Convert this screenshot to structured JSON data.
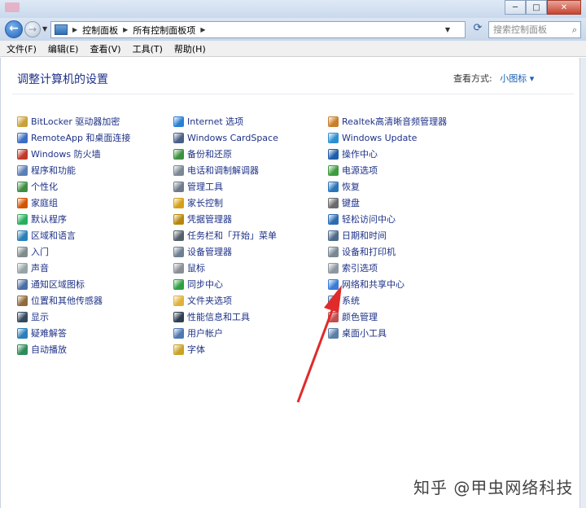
{
  "window": {
    "minimize_glyph": "─",
    "maximize_glyph": "□",
    "close_glyph": "✕"
  },
  "address": {
    "crumbs": [
      "控制面板",
      "所有控制面板项"
    ],
    "search_placeholder": "搜索控制面板"
  },
  "menu": [
    "文件(F)",
    "编辑(E)",
    "查看(V)",
    "工具(T)",
    "帮助(H)"
  ],
  "header": {
    "title": "调整计算机的设置",
    "view_by_label": "查看方式:",
    "view_by_value": "小图标 ▾"
  },
  "items": {
    "col1": [
      {
        "label": "BitLocker 驱动器加密",
        "color": "#c9a13a"
      },
      {
        "label": "RemoteApp 和桌面连接",
        "color": "#3a6fc4"
      },
      {
        "label": "Windows 防火墙",
        "color": "#c0392b"
      },
      {
        "label": "程序和功能",
        "color": "#5b7fb5"
      },
      {
        "label": "个性化",
        "color": "#3e8e41"
      },
      {
        "label": "家庭组",
        "color": "#d35400"
      },
      {
        "label": "默认程序",
        "color": "#27ae60"
      },
      {
        "label": "区域和语言",
        "color": "#2980b9"
      },
      {
        "label": "入门",
        "color": "#7f8c8d"
      },
      {
        "label": "声音",
        "color": "#95a5a6"
      },
      {
        "label": "通知区域图标",
        "color": "#4a6fa5"
      },
      {
        "label": "位置和其他传感器",
        "color": "#8e6b3a"
      },
      {
        "label": "显示",
        "color": "#34495e"
      },
      {
        "label": "疑难解答",
        "color": "#2c7fb8"
      },
      {
        "label": "自动播放",
        "color": "#2e8b57"
      }
    ],
    "col2": [
      {
        "label": "Internet 选项",
        "color": "#2a7fd4"
      },
      {
        "label": "Windows CardSpace",
        "color": "#4b5f86"
      },
      {
        "label": "备份和还原",
        "color": "#3d9140"
      },
      {
        "label": "电话和调制解调器",
        "color": "#7b8794"
      },
      {
        "label": "管理工具",
        "color": "#6c7a89"
      },
      {
        "label": "家长控制",
        "color": "#d4a017"
      },
      {
        "label": "凭据管理器",
        "color": "#b8860b"
      },
      {
        "label": "任务栏和「开始」菜单",
        "color": "#555f6b"
      },
      {
        "label": "设备管理器",
        "color": "#6d7f93"
      },
      {
        "label": "鼠标",
        "color": "#8a8f96"
      },
      {
        "label": "同步中心",
        "color": "#2ea043"
      },
      {
        "label": "文件夹选项",
        "color": "#e0b23c"
      },
      {
        "label": "性能信息和工具",
        "color": "#2d3e50"
      },
      {
        "label": "用户帐户",
        "color": "#4f77b0"
      },
      {
        "label": "字体",
        "color": "#c9a227"
      }
    ],
    "col3": [
      {
        "label": "Realtek高清晰音频管理器",
        "color": "#c87f2a"
      },
      {
        "label": "Windows Update",
        "color": "#2d8fd0"
      },
      {
        "label": "操作中心",
        "color": "#1f5fa8"
      },
      {
        "label": "电源选项",
        "color": "#3e9b3e"
      },
      {
        "label": "恢复",
        "color": "#2a74b8"
      },
      {
        "label": "键盘",
        "color": "#6b6b6b"
      },
      {
        "label": "轻松访问中心",
        "color": "#2b6cb0"
      },
      {
        "label": "日期和时间",
        "color": "#4e6a8a"
      },
      {
        "label": "设备和打印机",
        "color": "#7a8894"
      },
      {
        "label": "索引选项",
        "color": "#8d96a0"
      },
      {
        "label": "网络和共享中心",
        "color": "#3a7bd5"
      },
      {
        "label": "系统",
        "color": "#4c6fa0"
      },
      {
        "label": "颜色管理",
        "color": "#c24e4e"
      },
      {
        "label": "桌面小工具",
        "color": "#5a7fa8"
      }
    ]
  },
  "colors": {
    "link": "#1e3287",
    "annotation_arrow": "#e02b2b"
  },
  "watermark": "知乎 @甲虫网络科技"
}
